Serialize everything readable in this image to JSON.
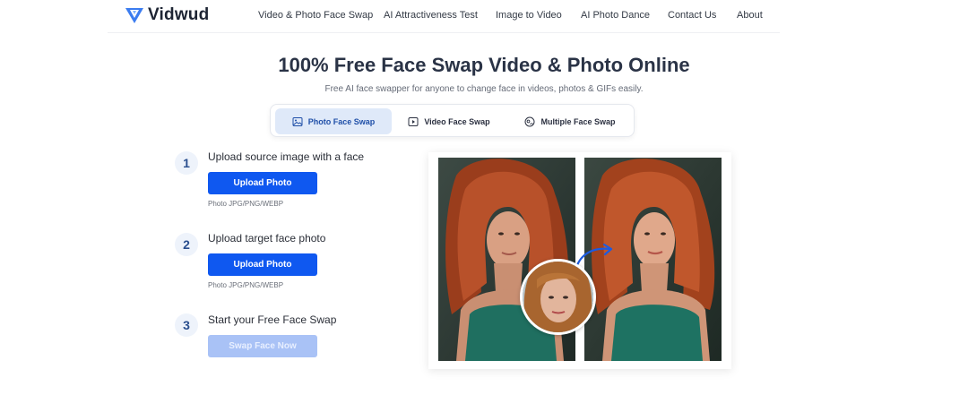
{
  "brand": {
    "name": "Vidwud",
    "accent": "#3b7cf0"
  },
  "nav": {
    "items": [
      {
        "label": "Video & Photo Face Swap"
      },
      {
        "label": "AI Attractiveness Test"
      },
      {
        "label": "Image to Video"
      },
      {
        "label": "AI Photo Dance"
      },
      {
        "label": "Contact Us"
      },
      {
        "label": "About"
      }
    ]
  },
  "hero": {
    "title": "100% Free Face Swap Video & Photo Online",
    "subtitle": "Free AI face swapper for anyone to change face in videos, photos & GIFs easily."
  },
  "tabs": [
    {
      "label": "Photo Face Swap",
      "icon": "image-icon",
      "active": true
    },
    {
      "label": "Video Face Swap",
      "icon": "video-icon",
      "active": false
    },
    {
      "label": "Multiple Face Swap",
      "icon": "face-group-icon",
      "active": false
    }
  ],
  "steps": [
    {
      "number": "1",
      "label": "Upload source image with a face",
      "button": "Upload Photo",
      "hint": "Photo JPG/PNG/WEBP"
    },
    {
      "number": "2",
      "label": "Upload target face photo",
      "button": "Upload Photo",
      "hint": "Photo JPG/PNG/WEBP"
    },
    {
      "number": "3",
      "label": "Start your Free Face Swap",
      "button": "Swap Face Now",
      "disabled": true
    }
  ],
  "colors": {
    "primary_button": "#0f58f0",
    "disabled_button": "#a9c2f6",
    "active_tab_bg": "#dfe9f9",
    "title": "#2a3346"
  }
}
